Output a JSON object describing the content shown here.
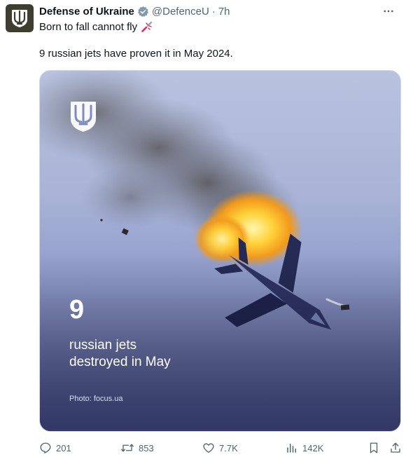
{
  "author": {
    "name": "Defense of Ukraine",
    "handle": "@DefenceU",
    "time": "7h",
    "verified": true
  },
  "post": {
    "line1": "Born to fall cannot fly",
    "line1_emoji": "broken-rocket",
    "line2": "9 russian jets have proven it in May 2024."
  },
  "media": {
    "big_number": "9",
    "caption_line1": "russian jets",
    "caption_line2": "destroyed in May",
    "credit": "Photo: focus.ua",
    "logo": "trident-shield"
  },
  "actions": {
    "replies": "201",
    "reposts": "853",
    "likes": "7.7K",
    "views": "142K"
  },
  "colors": {
    "text": "#0f1419",
    "muted": "#536471",
    "verified": "#829aab"
  }
}
